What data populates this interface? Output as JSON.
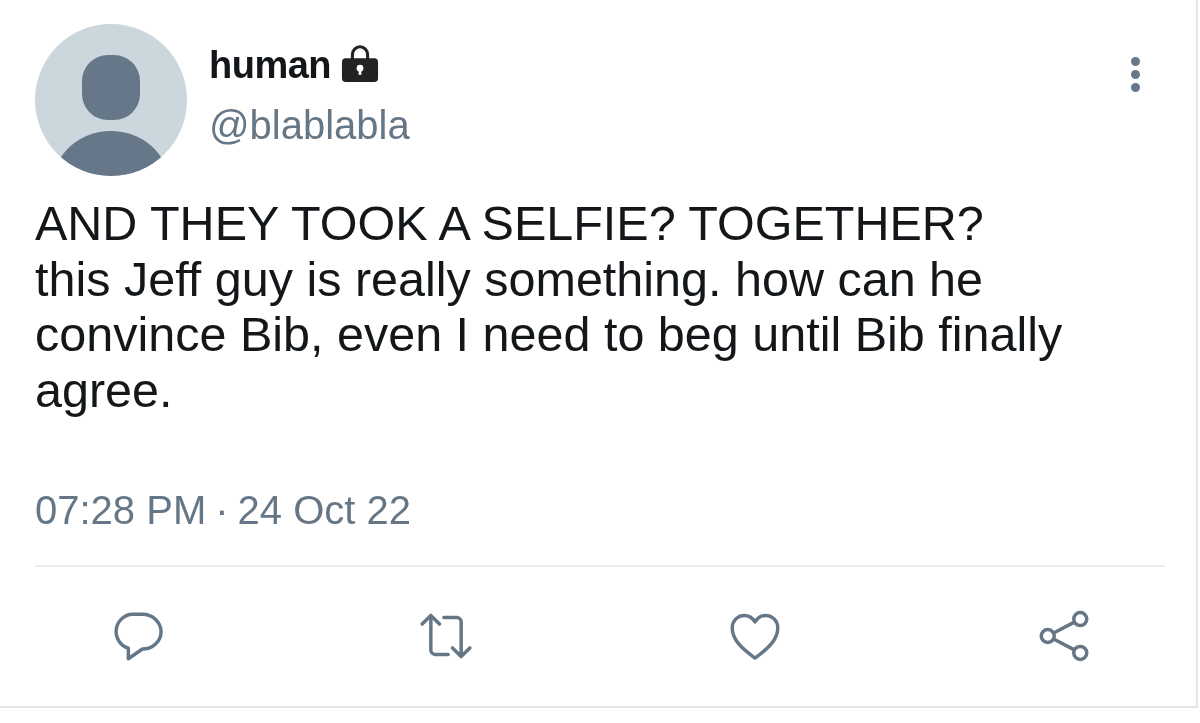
{
  "author": {
    "name": "human",
    "protected": true,
    "handle": "@blablabla"
  },
  "tweet": {
    "text": "AND THEY TOOK A SELFIE? TOGETHER?\nthis Jeff guy is really something. how can he convince Bib, even I need to beg until Bib finally agree."
  },
  "timestamp": {
    "time": "07:28 PM",
    "separator": "·",
    "date": "24 Oct 22"
  },
  "actions": [
    {
      "kind": "reply"
    },
    {
      "kind": "retweet"
    },
    {
      "kind": "like"
    },
    {
      "kind": "share"
    }
  ]
}
